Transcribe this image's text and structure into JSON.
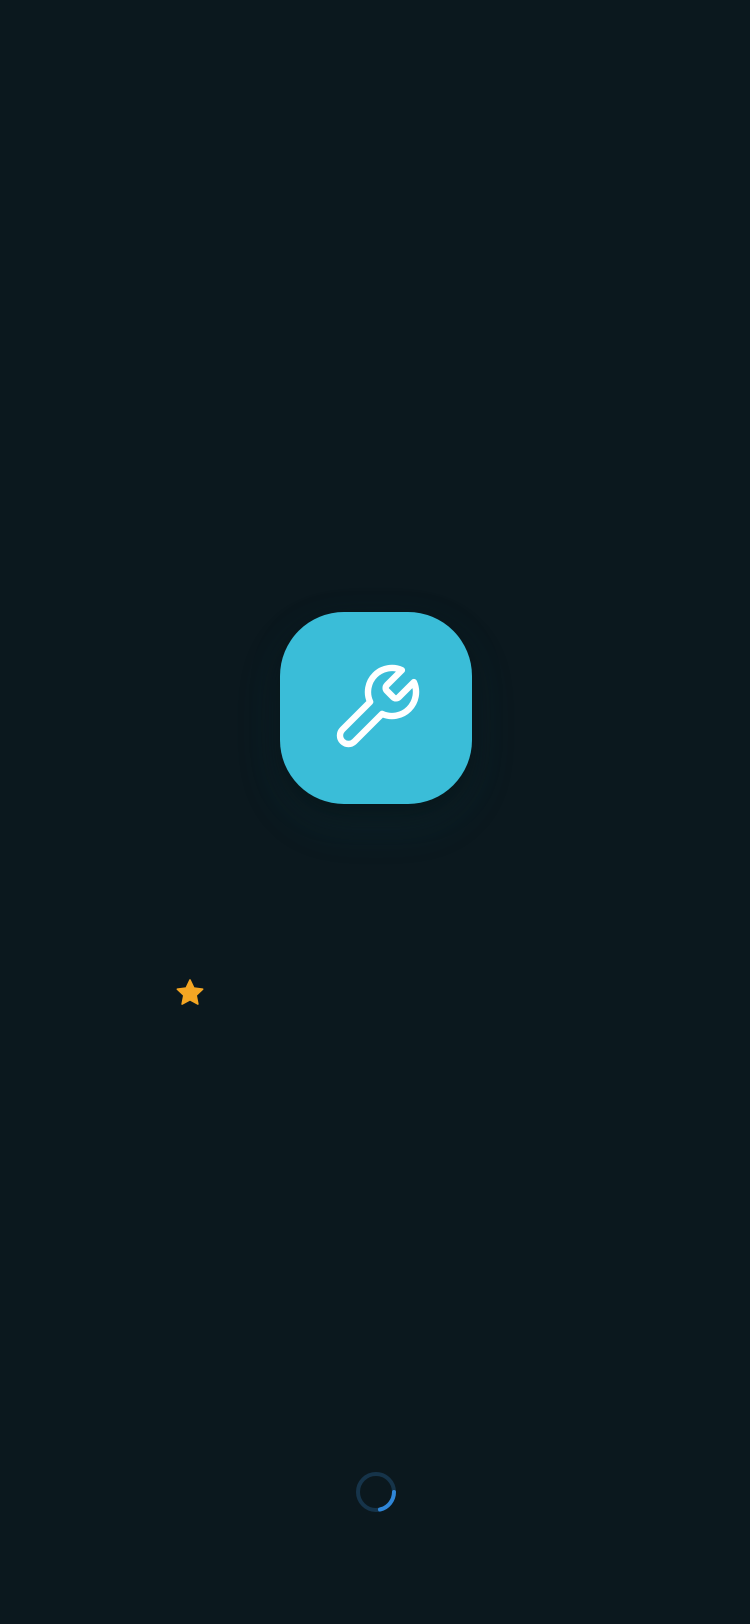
{
  "splash": {
    "app_icon": {
      "icon": "wrench-icon",
      "background_color": "#3abdd8",
      "icon_color": "#ffffff"
    },
    "decoration": {
      "icon": "star-icon",
      "color": "#f5a623"
    },
    "loading": {
      "icon": "loading-spinner",
      "track_color": "#16344a",
      "arc_color": "#2f86d8"
    }
  }
}
